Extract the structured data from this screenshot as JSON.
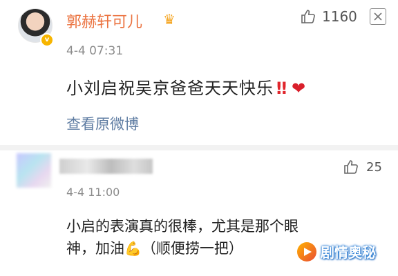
{
  "comments": [
    {
      "user": "郭赫轩可儿",
      "badge_icon": "crown-icon",
      "verified_icon": "v-badge-icon",
      "likes": "1160",
      "time": "4-4 07:31",
      "text": "小刘启祝吴京爸爸天天快乐",
      "emoji_bang": "‼",
      "emoji_heart": "❤",
      "action": "查看原微博"
    },
    {
      "likes": "25",
      "time": "4-4 11:00",
      "text_line1": "小启的表演真的很棒，尤其是那个眼",
      "text_line2_a": "神，加油",
      "emoji_muscle": "💪",
      "text_line2_b": "（顺便捞一把）"
    }
  ],
  "watermark": {
    "text": "剧情奥秘"
  },
  "colors": {
    "name": "#eb7340",
    "link": "#5f7da3",
    "meta": "#8c8c8c"
  }
}
